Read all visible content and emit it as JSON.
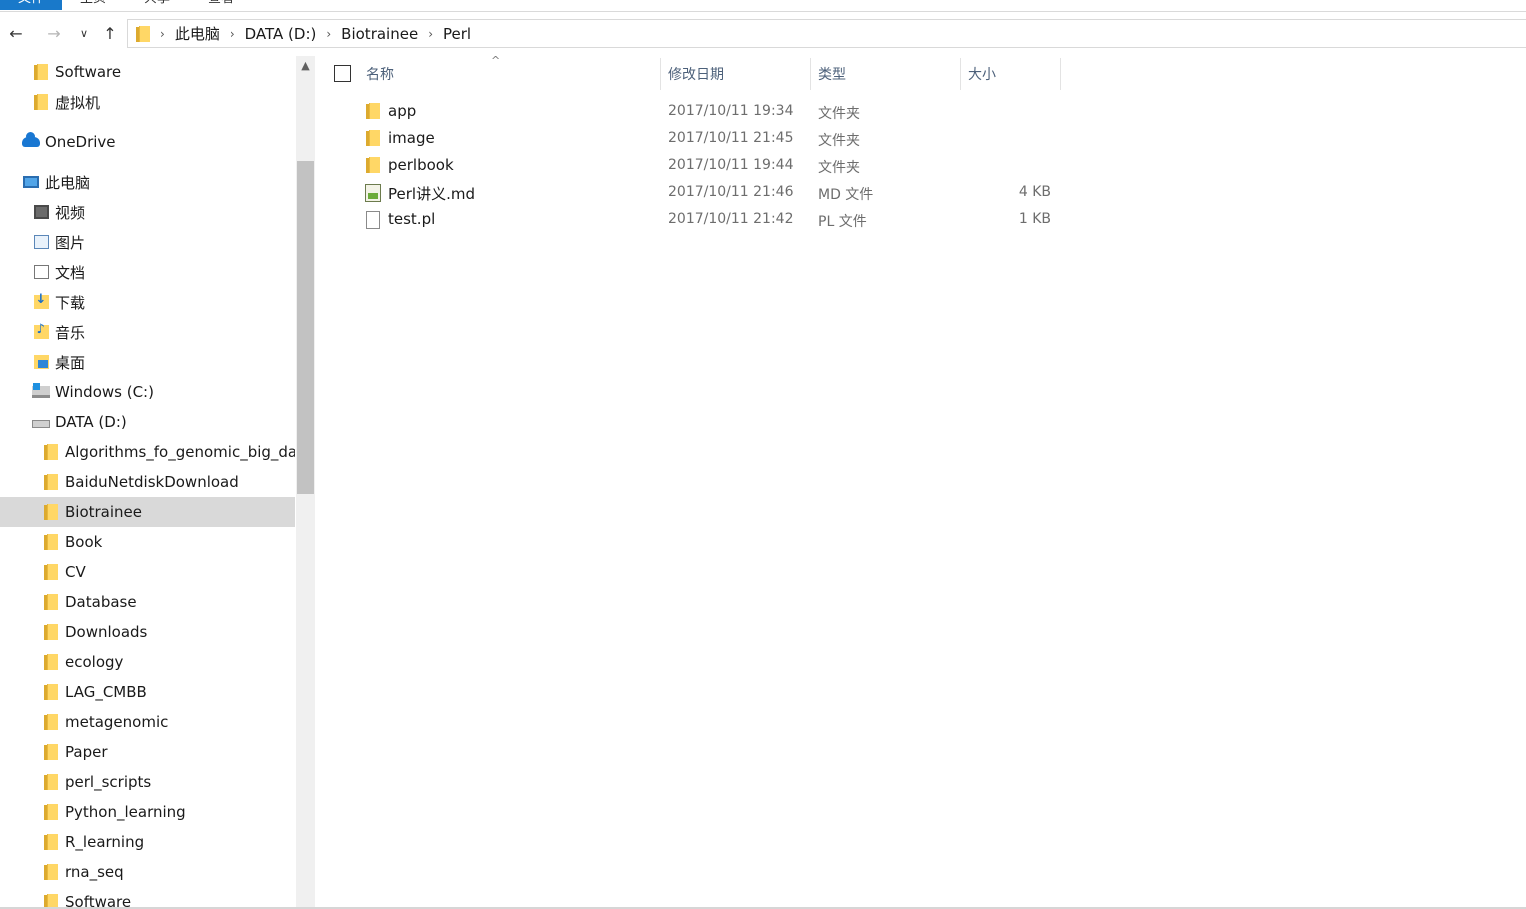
{
  "ribbon": {
    "tabs": [
      "文件",
      "主页",
      "共享",
      "查看"
    ]
  },
  "breadcrumb": [
    "此电脑",
    "DATA (D:)",
    "Biotrainee",
    "Perl"
  ],
  "nav_tree": [
    {
      "label": "Software",
      "icon": "folder-icon",
      "indent": 1
    },
    {
      "label": "虚拟机",
      "icon": "folder-icon",
      "indent": 1
    },
    {
      "label": "OneDrive",
      "icon": "onedrive-icon",
      "indent": 0
    },
    {
      "label": "此电脑",
      "icon": "computer-icon",
      "indent": 0
    },
    {
      "label": "视频",
      "icon": "videos-icon",
      "indent": 1
    },
    {
      "label": "图片",
      "icon": "pictures-icon",
      "indent": 1
    },
    {
      "label": "文档",
      "icon": "documents-icon",
      "indent": 1
    },
    {
      "label": "下载",
      "icon": "downloads-icon",
      "indent": 1
    },
    {
      "label": "音乐",
      "icon": "music-icon",
      "indent": 1
    },
    {
      "label": "桌面",
      "icon": "desktop-icon",
      "indent": 1
    },
    {
      "label": "Windows (C:)",
      "icon": "windows-drive-icon",
      "indent": 1
    },
    {
      "label": "DATA (D:)",
      "icon": "drive-icon",
      "indent": 1
    },
    {
      "label": "Algorithms_fo_genomic_big_da",
      "icon": "folder-icon",
      "indent": 2
    },
    {
      "label": "BaiduNetdiskDownload",
      "icon": "folder-icon",
      "indent": 2
    },
    {
      "label": "Biotrainee",
      "icon": "folder-icon",
      "indent": 2,
      "selected": true
    },
    {
      "label": "Book",
      "icon": "folder-icon",
      "indent": 2
    },
    {
      "label": "CV",
      "icon": "folder-icon",
      "indent": 2
    },
    {
      "label": "Database",
      "icon": "folder-icon",
      "indent": 2
    },
    {
      "label": "Downloads",
      "icon": "folder-icon",
      "indent": 2
    },
    {
      "label": "ecology",
      "icon": "folder-icon",
      "indent": 2
    },
    {
      "label": "LAG_CMBB",
      "icon": "folder-icon",
      "indent": 2
    },
    {
      "label": "metagenomic",
      "icon": "folder-icon",
      "indent": 2
    },
    {
      "label": "Paper",
      "icon": "folder-icon",
      "indent": 2
    },
    {
      "label": "perl_scripts",
      "icon": "folder-icon",
      "indent": 2
    },
    {
      "label": "Python_learning",
      "icon": "folder-icon",
      "indent": 2
    },
    {
      "label": "R_learning",
      "icon": "folder-icon",
      "indent": 2
    },
    {
      "label": "rna_seq",
      "icon": "folder-icon",
      "indent": 2
    },
    {
      "label": "Software",
      "icon": "folder-icon",
      "indent": 2
    }
  ],
  "columns": {
    "name": "名称",
    "date": "修改日期",
    "type": "类型",
    "size": "大小"
  },
  "files": [
    {
      "name": "app",
      "date": "2017/10/11 19:34",
      "type": "文件夹",
      "size": "",
      "icon": "folder-icon"
    },
    {
      "name": "image",
      "date": "2017/10/11 21:45",
      "type": "文件夹",
      "size": "",
      "icon": "folder-icon"
    },
    {
      "name": "perlbook",
      "date": "2017/10/11 19:44",
      "type": "文件夹",
      "size": "",
      "icon": "folder-icon"
    },
    {
      "name": "Perl讲义.md",
      "date": "2017/10/11 21:46",
      "type": "MD 文件",
      "size": "4 KB",
      "icon": "markdown-file-icon"
    },
    {
      "name": "test.pl",
      "date": "2017/10/11 21:42",
      "type": "PL 文件",
      "size": "1 KB",
      "icon": "file-icon"
    }
  ],
  "colors": {
    "accent": "#1979ca",
    "selection": "#d9d9d9",
    "folder": "#ffd766"
  }
}
